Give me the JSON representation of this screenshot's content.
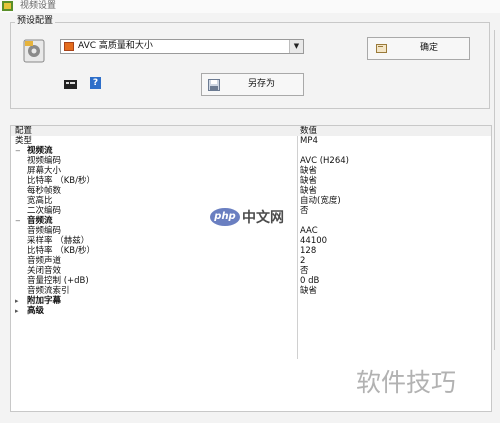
{
  "window": {
    "title": "视频设置"
  },
  "preset_group": {
    "label": "预设配置",
    "selected_preset": "AVC 高质量和大小",
    "ok_label": "确定",
    "saveas_label": "另存为"
  },
  "grid": {
    "header": {
      "name": "配置",
      "value": "数值"
    },
    "rows": [
      {
        "type": "item",
        "name": "类型",
        "value": "MP4"
      },
      {
        "type": "category",
        "toggle": "−",
        "name": "视频流",
        "value": ""
      },
      {
        "type": "item",
        "name": "视频编码",
        "value": "AVC (H264)"
      },
      {
        "type": "item",
        "name": "屏幕大小",
        "value": "缺省"
      },
      {
        "type": "item",
        "name": "比特率 （KB/秒）",
        "value": "缺省"
      },
      {
        "type": "item",
        "name": "每秒帧数",
        "value": "缺省"
      },
      {
        "type": "item",
        "name": "宽高比",
        "value": "自动(宽度)"
      },
      {
        "type": "item",
        "name": "二次编码",
        "value": "否"
      },
      {
        "type": "category",
        "toggle": "−",
        "name": "音频流",
        "value": ""
      },
      {
        "type": "item",
        "name": "音频编码",
        "value": "AAC"
      },
      {
        "type": "item",
        "name": "采样率 （赫兹）",
        "value": "44100"
      },
      {
        "type": "item",
        "name": "比特率 （KB/秒）",
        "value": "128"
      },
      {
        "type": "item",
        "name": "音频声道",
        "value": "2"
      },
      {
        "type": "item",
        "name": "关闭音效",
        "value": "否"
      },
      {
        "type": "item",
        "name": "音量控制 (+dB)",
        "value": "0 dB"
      },
      {
        "type": "item",
        "name": "音频流索引",
        "value": "缺省"
      },
      {
        "type": "category",
        "toggle": "▸",
        "name": "附加字幕",
        "value": ""
      },
      {
        "type": "category",
        "toggle": "▸",
        "name": "高级",
        "value": ""
      }
    ]
  },
  "watermarks": {
    "php_logo": "php",
    "php_text": "中文网",
    "tips": "软件技巧"
  }
}
